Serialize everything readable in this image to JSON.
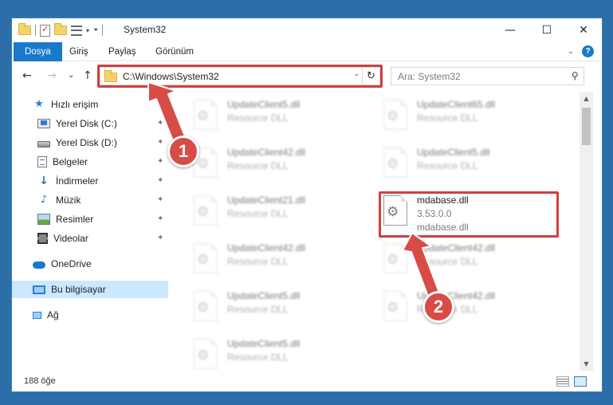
{
  "window": {
    "title": "System32",
    "controls": {
      "minimize": "—",
      "maximize": "☐",
      "close": "✕"
    }
  },
  "ribbon": {
    "tabs": [
      "Dosya",
      "Giriş",
      "Paylaş",
      "Görünüm"
    ],
    "expand_glyph": "⌄",
    "help_glyph": "?"
  },
  "nav": {
    "back_glyph": "←",
    "forward_glyph": "→",
    "recent_glyph": "⌄",
    "up_glyph": "↑",
    "address": "C:\\Windows\\System32",
    "refresh_glyph": "↻",
    "search_placeholder": "Ara: System32",
    "search_glyph": "⚲"
  },
  "sidebar": {
    "items": [
      {
        "label": "Hızlı erişim",
        "icon": "star-icon",
        "pinned": false
      },
      {
        "label": "Yerel Disk (C:)",
        "icon": "drive-c-icon",
        "pinned": true
      },
      {
        "label": "Yerel Disk (D:)",
        "icon": "drive-d-icon",
        "pinned": true
      },
      {
        "label": "Belgeler",
        "icon": "documents-icon",
        "pinned": true
      },
      {
        "label": "İndirmeler",
        "icon": "downloads-icon",
        "pinned": true
      },
      {
        "label": "Müzik",
        "icon": "music-icon",
        "pinned": true
      },
      {
        "label": "Resimler",
        "icon": "pictures-icon",
        "pinned": true
      },
      {
        "label": "Videolar",
        "icon": "videos-icon",
        "pinned": true
      },
      {
        "label": "OneDrive",
        "icon": "onedrive-icon",
        "pinned": false
      },
      {
        "label": "Bu bilgisayar",
        "icon": "this-pc-icon",
        "pinned": false,
        "selected": true
      },
      {
        "label": "Ağ",
        "icon": "network-icon",
        "pinned": false
      }
    ],
    "pin_glyph": "📌"
  },
  "files": {
    "column_left": [
      {
        "name": "UpdateClient5.dll",
        "type": "Resource DLL"
      },
      {
        "name": "UpdateClient42.dll",
        "type": "Resource DLL"
      },
      {
        "name": "UpdateClient21.dll",
        "type": "Resource DLL"
      },
      {
        "name": "UpdateClient42.dll",
        "type": "Resource DLL"
      },
      {
        "name": "UpdateClient5.dll",
        "type": "Resource DLL"
      },
      {
        "name": "UpdateClient5.dll",
        "type": "Resource DLL"
      }
    ],
    "column_right": [
      {
        "name": "UpdateClient65.dll",
        "type": "Resource DLL"
      },
      {
        "name": "UpdateClient5.dll",
        "type": "Resource DLL"
      },
      {
        "name": "mdabase.dll",
        "type": "3.53.0.0",
        "extra": "mdabase.dll",
        "highlighted": true
      },
      {
        "name": "UpdateClient42.dll",
        "type": "Resource DLL"
      },
      {
        "name": "UpdateClient42.dll",
        "type": "Resource DLL"
      }
    ]
  },
  "status": {
    "item_count": "188 öğe"
  },
  "callouts": {
    "step1": "1",
    "step2": "2",
    "color": "#d84c47"
  },
  "scrollbar": {
    "up_glyph": "▲",
    "down_glyph": "▼"
  }
}
